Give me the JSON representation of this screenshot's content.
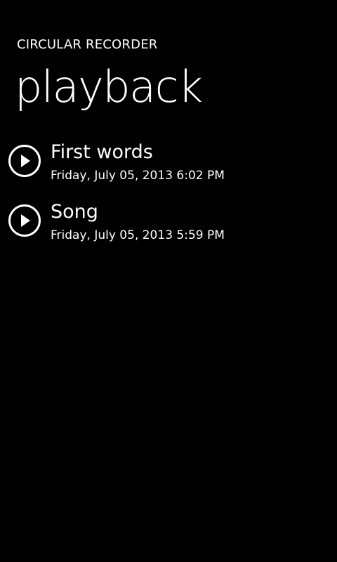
{
  "app": {
    "title": "CIRCULAR RECORDER"
  },
  "page": {
    "title": "playback"
  },
  "recordings": [
    {
      "title": "First words",
      "date": "Friday, July 05, 2013 6:02 PM",
      "icon": "play-icon"
    },
    {
      "title": "Song",
      "date": "Friday, July 05, 2013 5:59 PM",
      "icon": "play-icon"
    }
  ],
  "colors": {
    "background": "#000000",
    "foreground": "#ffffff"
  }
}
